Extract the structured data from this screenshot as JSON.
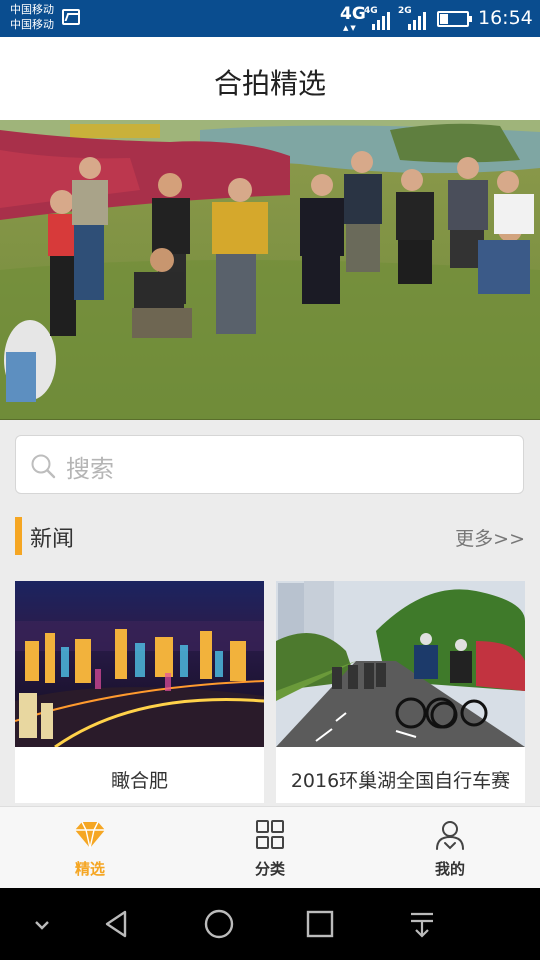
{
  "status_bar": {
    "carrier_1": "中国移动",
    "carrier_2": "中国移动",
    "network_main": "4G",
    "sim1_label": "4G",
    "sim2_label": "2G",
    "time": "16:54",
    "battery_level": 0.3
  },
  "header": {
    "title": "合拍精选"
  },
  "search": {
    "placeholder": "搜索"
  },
  "news": {
    "title": "新闻",
    "more_label": "更多>>",
    "cards": [
      {
        "caption": "瞰合肥"
      },
      {
        "caption": "2016环巢湖全国自行车赛"
      }
    ]
  },
  "tabs": [
    {
      "label": "精选",
      "icon": "diamond-icon",
      "active": true
    },
    {
      "label": "分类",
      "icon": "grid-icon",
      "active": false
    },
    {
      "label": "我的",
      "icon": "profile-icon",
      "active": false
    }
  ],
  "colors": {
    "status_bar": "#0a4d8f",
    "accent": "#f5a623",
    "tab_inactive": "#333333"
  }
}
